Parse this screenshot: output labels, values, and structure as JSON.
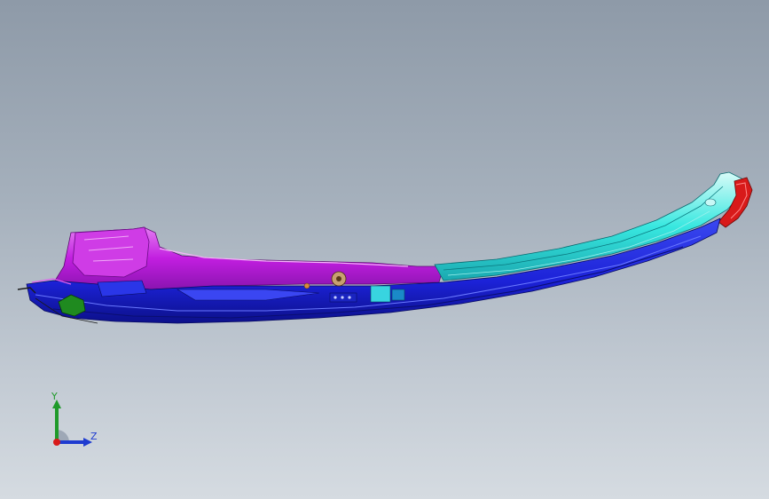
{
  "viewport": {
    "background_top": "#8e9aa8",
    "background_bottom": "#d5dbe1"
  },
  "model": {
    "description_icon": "cad-part-icon",
    "colors": {
      "magenta": "#c21ee0",
      "magenta_light": "#e88af0",
      "blue": "#1c22d8",
      "blue_dark": "#0c108a",
      "cyan": "#38e8e0",
      "cyan_light": "#b8f6f2",
      "red": "#d81a1a",
      "green": "#1f8a1f",
      "orange": "#d88a3a"
    }
  },
  "triad": {
    "y_label": "Y",
    "z_label": "Z",
    "y_color": "#1f9a2a",
    "z_color": "#1f3cd0",
    "x_color": "#d81a1a"
  }
}
